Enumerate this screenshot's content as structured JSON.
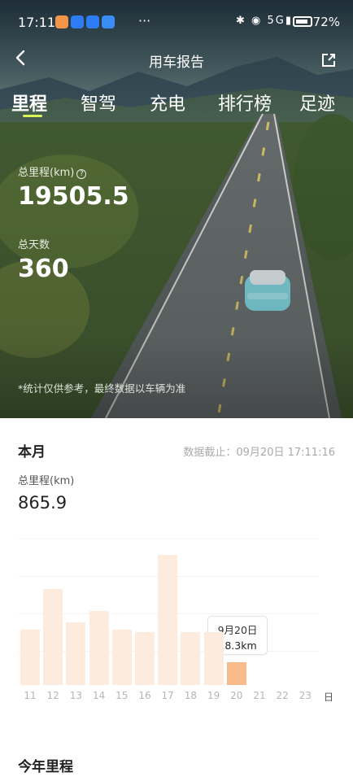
{
  "status_bar": {
    "time": "17:11",
    "more": "···",
    "signal": "5G",
    "battery": "72%"
  },
  "nav": {
    "title": "用车报告"
  },
  "tabs": [
    {
      "label": "里程",
      "active": true
    },
    {
      "label": "智驾",
      "active": false
    },
    {
      "label": "充电",
      "active": false
    },
    {
      "label": "排行榜",
      "active": false
    },
    {
      "label": "足迹",
      "active": false
    }
  ],
  "hero": {
    "total_mileage_label": "总里程(km)",
    "total_mileage_value": "19505.5",
    "total_days_label": "总天数",
    "total_days_value": "360",
    "note": "*统计仅供参考，最终数据以车辆为准"
  },
  "month": {
    "title": "本月",
    "cutoff": "数据截止：09月20日 17:11:16",
    "mileage_label": "总里程(km)",
    "mileage_value": "865.9",
    "tooltip_date": "9月20日",
    "tooltip_value": "18.3km",
    "unit": "日"
  },
  "chart_data": {
    "type": "bar",
    "categories": [
      "11",
      "12",
      "13",
      "14",
      "15",
      "16",
      "17",
      "18",
      "19",
      "20",
      "21",
      "22",
      "23"
    ],
    "values": [
      44,
      76,
      50,
      59,
      44,
      42,
      103,
      42,
      42,
      18.3,
      0,
      0,
      0
    ],
    "selected_index": 9,
    "ylim": [
      0,
      120
    ],
    "grid": true
  },
  "year": {
    "title": "今年里程"
  },
  "icons": {
    "back": "chevron-left-icon",
    "share": "share-icon",
    "info": "question-circle-icon",
    "bar_selected_color": "#f8bc8a",
    "bar_color": "#fdebdd"
  }
}
